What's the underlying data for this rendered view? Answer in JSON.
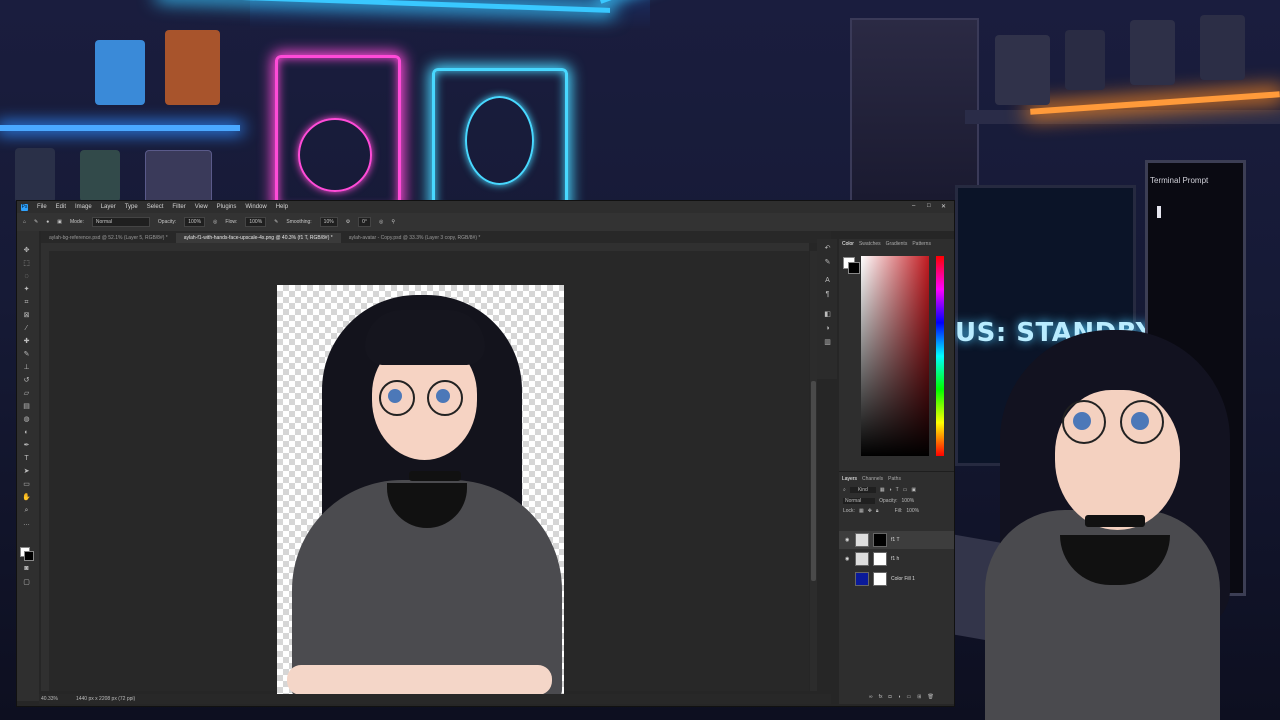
{
  "background": {
    "monitor_text": "US: STANDBY",
    "terminal_title": "Terminal Prompt"
  },
  "app": {
    "menu": [
      "File",
      "Edit",
      "Image",
      "Layer",
      "Type",
      "Select",
      "Filter",
      "View",
      "Plugins",
      "Window",
      "Help"
    ],
    "options": {
      "mode_label": "Mode:",
      "mode_value": "Normal",
      "opacity_label": "Opacity:",
      "opacity_value": "100%",
      "flow_label": "Flow:",
      "flow_value": "100%",
      "smoothing_label": "Smoothing:",
      "smoothing_value": "10%",
      "angle_value": "0°"
    },
    "tabs": [
      "aylah-bg-reference.psd @ 52.1% (Layer 5, RGB/8#) *",
      "aylah-f1-with-hands-face-upscale-4x.png @ 40.3% (f1 T, RGB/8#) *",
      "aylah-avatar - Copy.psd @ 33.3% (Layer 3 copy, RGB/8#) *"
    ],
    "status": {
      "zoom": "40.33%",
      "doc_size": "1440 px x 2208 px (72 ppi)"
    },
    "color_panel": {
      "tabs": [
        "Color",
        "Swatches",
        "Gradients",
        "Patterns"
      ]
    },
    "layers_panel": {
      "tabs": [
        "Layers",
        "Channels",
        "Paths"
      ],
      "filter_label": "Kind",
      "blend_mode": "Normal",
      "opacity_label": "Opacity:",
      "opacity_value": "100%",
      "lock_label": "Lock:",
      "fill_label": "Fill:",
      "fill_value": "100%",
      "layers": [
        {
          "name": "f1 T"
        },
        {
          "name": "f1 h"
        },
        {
          "name": "Color Fill 1"
        }
      ]
    }
  }
}
